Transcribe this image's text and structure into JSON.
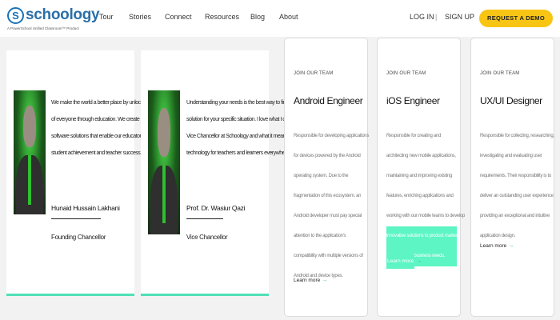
{
  "brand": {
    "name": "schoology",
    "tagline": "A PowerSchool Unified Classroom™ Product",
    "accent": "#1a73b7"
  },
  "nav": {
    "links": [
      "Tour",
      "Stories",
      "Connect",
      "Resources",
      "Blog",
      "About"
    ],
    "login": "LOG IN",
    "separator": "|",
    "signup": "SIGN UP",
    "cta": "REQUEST A DEMO",
    "cta_color": "#f9c515"
  },
  "leaders": [
    {
      "quote_lines": [
        "We make the world a better place by unlocking the power",
        "of everyone through education. We create incredible, intuitive",
        "software solutions that enable our educators to improve",
        "student achievement and teacher success."
      ],
      "name": "Hunaid Hussain Lakhani",
      "role": "Founding Chancellor"
    },
    {
      "quote_lines": [
        "Understanding your needs is the best way to find the right",
        "solution for your specific situation. I love what I do as",
        "Vice Chancellor at Schoology and what it means to provide",
        "technology for teachers and learners everywhere."
      ],
      "name": "Prof. Dr. Wasiur Qazi",
      "role": "Vice Chancellor"
    }
  ],
  "jobs": [
    {
      "eyebrow": "JOIN OUR TEAM",
      "title": "Android Engineer",
      "desc_lines": [
        "Responsible for developing applications",
        "for devices powered by the Android",
        "operating system. Due to the",
        "fragmentation of this ecosystem, an",
        "Android developer must pay special",
        "attention to the application's",
        "compatibility with multiple versions of",
        "Android and device types."
      ],
      "learn_more": "Learn more",
      "arrow": "→"
    },
    {
      "eyebrow": "JOIN OUR TEAM",
      "title": "iOS Engineer",
      "desc_lines": [
        "Responsible for creating and",
        "architecting new mobile applications,",
        "maintaining and improving existing",
        "features, enriching applications and",
        "working with our mobile teams to develop",
        "innovative solutions to product market",
        "demands and business needs."
      ],
      "learn_more": "Learn more",
      "arrow": "→",
      "highlight_color": "#5cf5c3"
    },
    {
      "eyebrow": "JOIN OUR TEAM",
      "title": "UX/UI Designer",
      "desc_lines": [
        "Responsible for collecting, researching,",
        "investigating and evaluating user",
        "requirements. Their responsibility is to",
        "deliver an outstanding user experience",
        "providing an exceptional and intuitive",
        "application design."
      ],
      "learn_more": "Learn more",
      "arrow": "→"
    }
  ]
}
